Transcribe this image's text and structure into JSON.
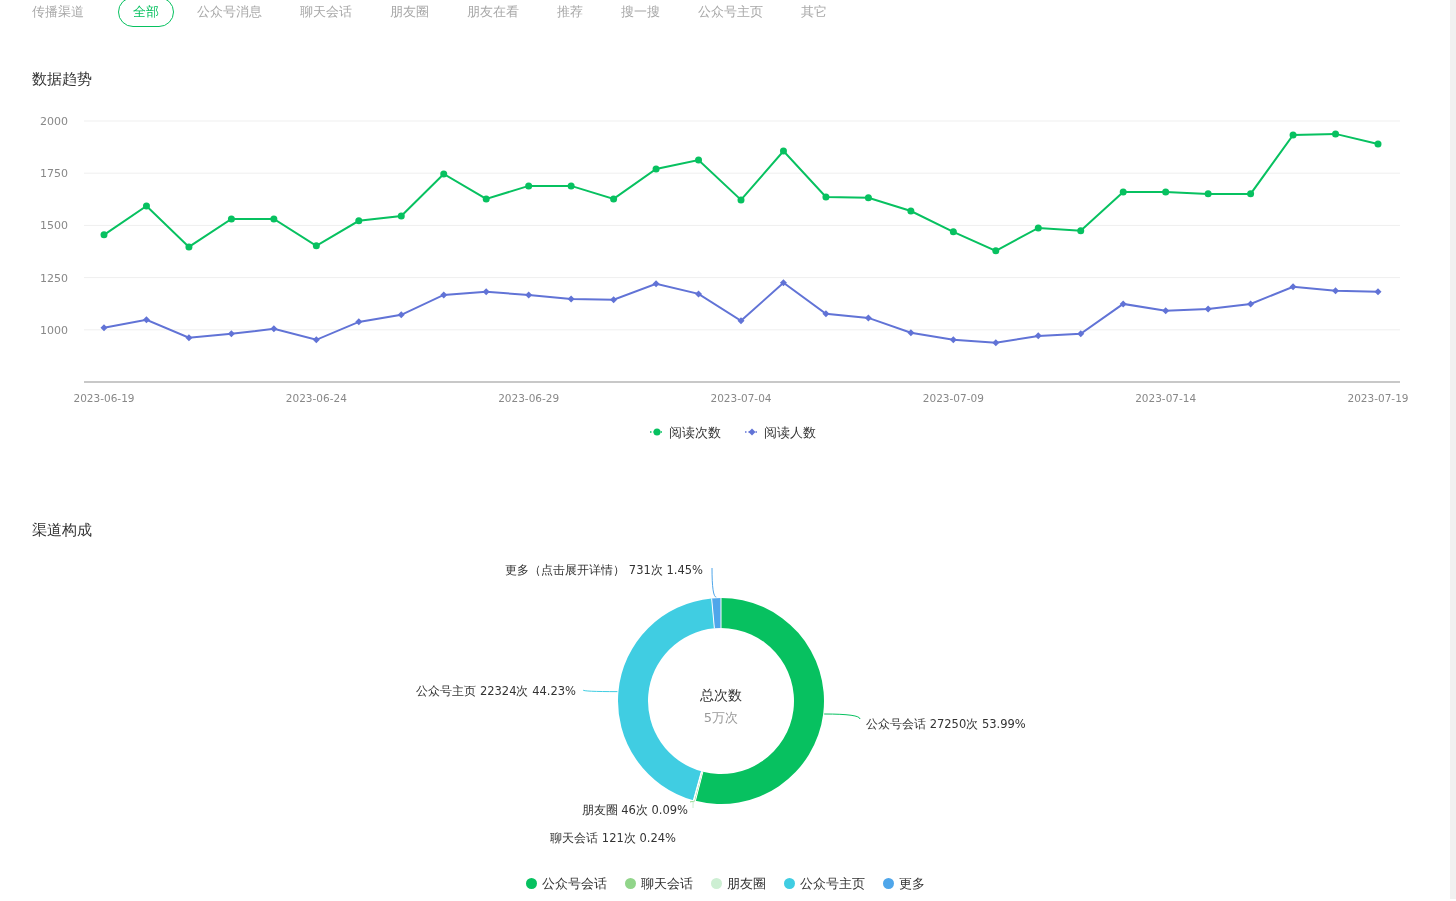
{
  "channel_filter": {
    "label": "传播渠道",
    "tabs": [
      {
        "label": "全部",
        "selected": true
      },
      {
        "label": "公众号消息",
        "selected": false
      },
      {
        "label": "聊天会话",
        "selected": false
      },
      {
        "label": "朋友圈",
        "selected": false
      },
      {
        "label": "朋友在看",
        "selected": false
      },
      {
        "label": "推荐",
        "selected": false
      },
      {
        "label": "搜一搜",
        "selected": false
      },
      {
        "label": "公众号主页",
        "selected": false
      },
      {
        "label": "其它",
        "selected": false
      }
    ]
  },
  "trend": {
    "title": "数据趋势",
    "chart_data": {
      "type": "line",
      "categories": [
        "2023-06-19",
        null,
        null,
        null,
        null,
        "2023-06-24",
        null,
        null,
        null,
        null,
        "2023-06-29",
        null,
        null,
        null,
        null,
        "2023-07-04",
        null,
        null,
        null,
        null,
        "2023-07-09",
        null,
        null,
        null,
        null,
        "2023-07-14",
        null,
        null,
        null,
        null,
        "2023-07-19"
      ],
      "ylim": [
        750,
        2000
      ],
      "yticks": [
        1000,
        1250,
        1500,
        1750,
        2000
      ],
      "grid": true,
      "legend": "bottom",
      "series": [
        {
          "name": "阅读次数",
          "color": "#07c160",
          "marker": "circle",
          "values": [
            1455,
            1593,
            1397,
            1531,
            1531,
            1402,
            1522,
            1545,
            1746,
            1627,
            1689,
            1689,
            1627,
            1770,
            1813,
            1622,
            1856,
            1636,
            1632,
            1569,
            1469,
            1378,
            1488,
            1474,
            1660,
            1660,
            1651,
            1651,
            1933,
            1938,
            1890
          ]
        },
        {
          "name": "阅读人数",
          "color": "#6173d6",
          "marker": "diamond",
          "values": [
            1010,
            1048,
            962,
            981,
            1005,
            952,
            1038,
            1072,
            1167,
            1182,
            1167,
            1148,
            1144,
            1220,
            1172,
            1043,
            1225,
            1077,
            1057,
            986,
            952,
            938,
            971,
            981,
            1124,
            1091,
            1100,
            1124,
            1206,
            1187,
            1182
          ]
        }
      ]
    }
  },
  "composition": {
    "title": "渠道构成",
    "center_title": "总次数",
    "center_value": "5万次",
    "chart_data": {
      "type": "donut",
      "legend": "bottom",
      "categories": [
        "公众号会话",
        "聊天会话",
        "朋友圈",
        "公众号主页",
        "更多"
      ],
      "values": [
        27250,
        121,
        46,
        22324,
        731
      ],
      "colors": [
        "#07c160",
        "#91d58a",
        "#cdefd3",
        "#40cde2",
        "#4fa6ea"
      ],
      "value_labels": [
        "公众号会话 27250次 53.99%",
        "聊天会话 121次 0.24%",
        "朋友圈 46次 0.09%",
        "公众号主页 22324次 44.23%",
        "更多（点击展开详情） 731次 1.45%"
      ]
    }
  }
}
